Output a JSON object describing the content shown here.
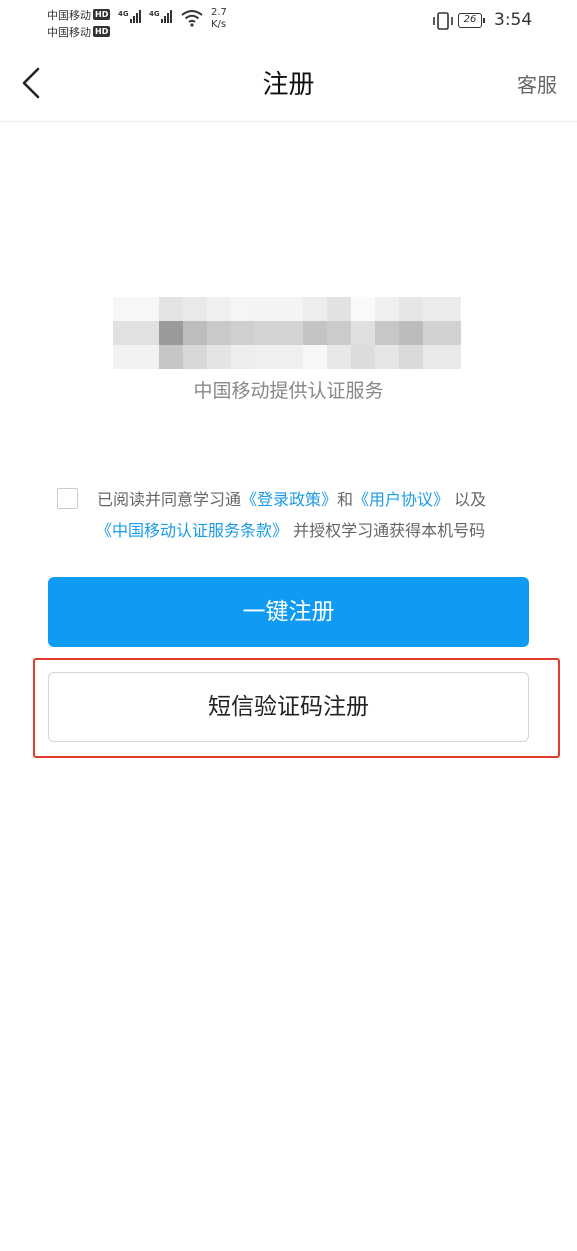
{
  "status_bar": {
    "carrier1": "中国移动",
    "carrier2": "中国移动",
    "hd_badge": "HD",
    "network1": "4G",
    "network2": "4G",
    "speed_value": "2.7",
    "speed_unit": "K/s",
    "battery": "26",
    "time": "3:54"
  },
  "nav": {
    "title": "注册",
    "service": "客服"
  },
  "provider_text": "中国移动提供认证服务",
  "agreement": {
    "part1": "已阅读并同意学习通",
    "link_login_policy": "《登录政策》",
    "and": "和",
    "link_user_agreement": "《用户协议》",
    "and_also": "以及",
    "link_cmcc_terms": "《中国移动认证服务条款》",
    "part2": "并授权学习通获得本机号码"
  },
  "buttons": {
    "one_click": "一键注册",
    "sms": "短信验证码注册"
  },
  "colors": {
    "primary": "#0f9af3",
    "link": "#1a9be6",
    "highlight": "#e03c2c"
  }
}
